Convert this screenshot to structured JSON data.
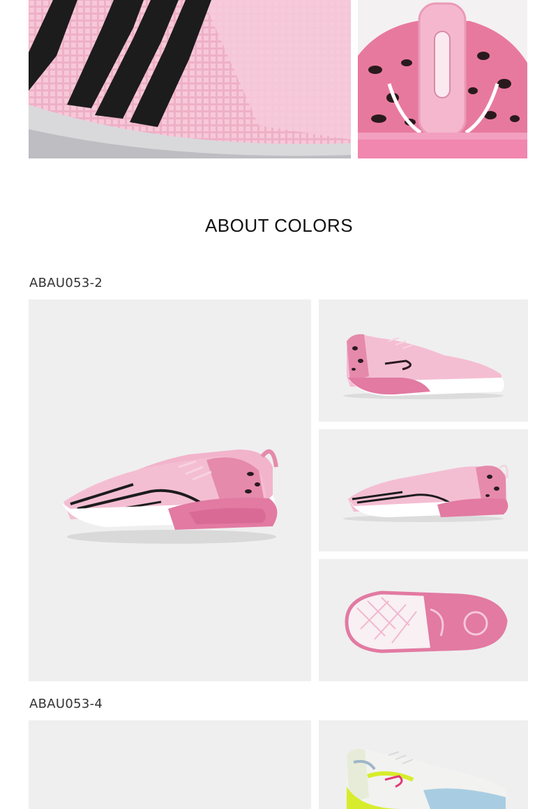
{
  "section_title": "ABOUT COLORS",
  "variants": [
    {
      "code": "ABAU053-2"
    },
    {
      "code": "ABAU053-4"
    }
  ],
  "colors": {
    "background": "#ffffff",
    "panel": "#efefef",
    "pink_upper": "#f2b8cf",
    "pink_sole": "#e27aa2",
    "stripe": "#1c1c1c",
    "lime": "#d7ec2c"
  },
  "images": [
    {
      "name": "closeup-upper-stripes"
    },
    {
      "name": "closeup-heel-leopard"
    },
    {
      "name": "shoe-pair-main"
    },
    {
      "name": "shoe-lateral-view"
    },
    {
      "name": "shoe-medial-view"
    },
    {
      "name": "shoe-outsole-view"
    },
    {
      "name": "shoe-blank-panel"
    },
    {
      "name": "shoe-lime-white-view"
    }
  ]
}
